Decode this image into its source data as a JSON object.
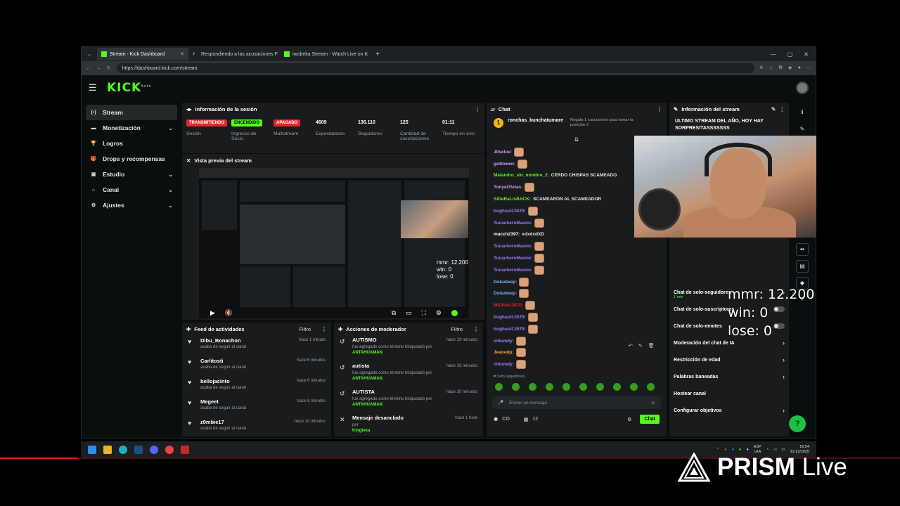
{
  "browser": {
    "tabs": [
      {
        "label": "Stream - Kick Dashboard",
        "active": true
      },
      {
        "label": "Respondiendo a las acusaciones F",
        "active": false
      },
      {
        "label": "iwobeka Stream - Watch Live on K",
        "active": false
      }
    ],
    "url": "https://dashboard.kick.com/stream"
  },
  "kick": {
    "logo": "KICK",
    "logo_sup": "beta"
  },
  "sidebar": {
    "items": [
      {
        "label": "Stream",
        "icon": "broadcast-icon",
        "glyph": "(•)",
        "active": true,
        "chevron": false
      },
      {
        "label": "Monetización",
        "icon": "wallet-icon",
        "glyph": "▬",
        "active": false,
        "chevron": true
      },
      {
        "label": "Logros",
        "icon": "trophy-icon",
        "glyph": "🏆",
        "active": false,
        "chevron": false
      },
      {
        "label": "Drops y recompensas",
        "icon": "gift-icon",
        "glyph": "🎁",
        "active": false,
        "chevron": false
      },
      {
        "label": "Estudio",
        "icon": "studio-icon",
        "glyph": "▣",
        "active": false,
        "chevron": true
      },
      {
        "label": "Canal",
        "icon": "channel-icon",
        "glyph": "⌂",
        "active": false,
        "chevron": true
      },
      {
        "label": "Ajustes",
        "icon": "gear-icon",
        "glyph": "⚙",
        "active": false,
        "chevron": true
      }
    ]
  },
  "session": {
    "title": "Información de la sesión",
    "stats": [
      {
        "value": "TRANSMITIENDO",
        "label": "Sesión",
        "style": "red"
      },
      {
        "value": "ENCENDIDO",
        "label": "Ingresos de Socio",
        "style": "green"
      },
      {
        "value": "APAGADO",
        "label": "Multistream",
        "style": "red"
      },
      {
        "value": "4609",
        "label": "Espectadores",
        "style": "plain"
      },
      {
        "value": "136.110",
        "label": "Seguidores",
        "style": "plain"
      },
      {
        "value": "125",
        "label": "Cantidad de suscripciones",
        "style": "plain"
      },
      {
        "value": "01:11",
        "label": "Tiempo en vivo",
        "style": "plain"
      }
    ]
  },
  "preview": {
    "title": "Vista previa del stream",
    "overlay": [
      "mmr: 12.200",
      "win: 0",
      "lose: 0"
    ]
  },
  "feed": {
    "title": "Feed de actividades",
    "filter": "Filtro",
    "items": [
      {
        "name": "Dibu_Bonachon",
        "sub": "acaba de seguir al canal",
        "time": "hace 1 minuto"
      },
      {
        "name": "Carlitosti",
        "sub": "acaba de seguir al canal",
        "time": "hace 6 minutos"
      },
      {
        "name": "bellojacinto",
        "sub": "acaba de seguir al canal",
        "time": "hace 6 minutos"
      },
      {
        "name": "Megeet",
        "sub": "acaba de seguir al canal",
        "time": "hace 8 minutos"
      },
      {
        "name": "z0mbie17",
        "sub": "acaba de seguir al canal",
        "time": "hace 10 minutos"
      }
    ]
  },
  "modactions": {
    "title": "Acciones de moderador",
    "filter": "Filtro",
    "items": [
      {
        "name": "AUTISMO",
        "sub": "fue agregado como término bloqueado por",
        "by": "ANTAHUAMAN",
        "time": "hace 19 minutos",
        "icon": "undo-icon",
        "glyph": "↺"
      },
      {
        "name": "autista",
        "sub": "fue agregado como término bloqueado por",
        "by": "ANTAHUAMAN",
        "time": "hace 19 minutos",
        "icon": "undo-icon",
        "glyph": "↺"
      },
      {
        "name": "AUTISTA",
        "sub": "fue agregado como término bloqueado por",
        "by": "ANTAHUAMAN",
        "time": "hace 20 minutos",
        "icon": "undo-icon",
        "glyph": "↺"
      },
      {
        "name": "Mensaje desanclado",
        "sub": "por",
        "by": "Kingteka",
        "time": "hace 1 hora",
        "icon": "unpin-icon",
        "glyph": "✕"
      }
    ]
  },
  "chat": {
    "title": "Chat",
    "pinned_user": "ronchas_kunchatumare",
    "pinned_gift": "Regala 1 suscripción para tomar la posición 2",
    "messages": [
      {
        "user": "J0seluv:",
        "color": "#c9a0ff",
        "text": "",
        "emotes": 1
      },
      {
        "user": "gottowen:",
        "color": "#c9a0ff",
        "text": "",
        "emotes": 1
      },
      {
        "user": "Malandro_sin_nombre_2:",
        "color": "#53fc18",
        "text": "CERDO CHISPAS SCAMEADO",
        "emotes": 0
      },
      {
        "user": "Tonyel7tetas:",
        "color": "#c9a0ff",
        "text": "",
        "emotes": 1
      },
      {
        "user": "SiDeRaLisBACK:",
        "color": "#53fc18",
        "text": "SCAMEARON AL SCAMEADOR",
        "emotes": 0
      },
      {
        "user": "bughuul13579:",
        "color": "#a07cff",
        "text": "",
        "emotes": 1
      },
      {
        "user": "TucacheroMasno:",
        "color": "#a07cff",
        "text": "",
        "emotes": 1
      },
      {
        "user": "macch2397:",
        "color": "#ffffff",
        "text": "xdxdxdXD",
        "emotes": 0
      },
      {
        "user": "TucacheroMasno:",
        "color": "#a07cff",
        "text": "",
        "emotes": 1
      },
      {
        "user": "TucacheroMasno:",
        "color": "#a07cff",
        "text": "",
        "emotes": 1
      },
      {
        "user": "TucacheroMasno:",
        "color": "#a07cff",
        "text": "",
        "emotes": 1
      },
      {
        "user": "Dotasleep:",
        "color": "#7cb7ff",
        "text": "",
        "emotes": 1
      },
      {
        "user": "Dotasleep:",
        "color": "#7cb7ff",
        "text": "",
        "emotes": 1
      },
      {
        "user": "MiChixLOCO:",
        "color": "#e0292c",
        "text": "",
        "emotes": 1
      },
      {
        "user": "bughuul13579:",
        "color": "#a07cff",
        "text": "",
        "emotes": 1
      },
      {
        "user": "bughuul13579:",
        "color": "#a07cff",
        "text": "",
        "emotes": 1
      },
      {
        "user": "oldsmdy:",
        "color": "#a07cff",
        "text": "",
        "emotes": 1
      },
      {
        "user": "Jeanedp:",
        "color": "#ff9d3a",
        "text": "",
        "emotes": 1
      },
      {
        "user": "oldsmdy:",
        "color": "#a07cff",
        "text": "",
        "emotes": 1
      }
    ],
    "followers_only": "Solo seguidores",
    "input_placeholder": "Enviar un mensaje",
    "footer_left": "CO",
    "footer_count": "12",
    "send_label": "Chat"
  },
  "streaminfo": {
    "title": "Información del stream",
    "stream_title": "ULTIMO STREAM DEL AÑO, HOY HAY SORPRESITASSSSSSS",
    "settings": [
      {
        "label": "Chat de solo-seguidores",
        "sub": "1 min",
        "kind": "chevron"
      },
      {
        "label": "Chat de solo-suscriptores",
        "sub": "",
        "kind": "toggle"
      },
      {
        "label": "Chat de solo-emotes",
        "sub": "",
        "kind": "toggle"
      },
      {
        "label": "Moderación del chat de IA",
        "sub": "",
        "kind": "chevron"
      },
      {
        "label": "Restricción de edad",
        "sub": "",
        "kind": "chevron"
      },
      {
        "label": "Palabras baneadas",
        "sub": "",
        "kind": "chevron"
      },
      {
        "label": "Hostear canal",
        "sub": "",
        "kind": "none"
      },
      {
        "label": "Configurar objetivos",
        "sub": "",
        "kind": "chevron"
      }
    ]
  },
  "overlay_stats": [
    "mmr: 12.200",
    "win: 0",
    "lose: 0"
  ],
  "taskbar": {
    "lang": "ESP",
    "lang2": "LAA",
    "time": "16:54",
    "date": "31/12/2025"
  },
  "watermark": {
    "brand": "PRISM",
    "suffix": "Live"
  }
}
